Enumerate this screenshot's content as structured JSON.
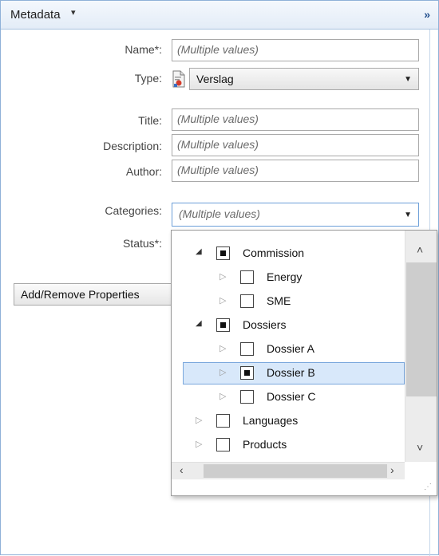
{
  "panel": {
    "title": "Metadata",
    "title_caret": "▾",
    "collapse_label": "»"
  },
  "fields": {
    "name": {
      "label": "Name*:",
      "value": "(Multiple values)"
    },
    "type": {
      "label": "Type:",
      "value": "Verslag",
      "icon": "document-report-icon"
    },
    "title": {
      "label": "Title:",
      "value": "(Multiple values)"
    },
    "description": {
      "label": "Description:",
      "value": "(Multiple values)"
    },
    "author": {
      "label": "Author:",
      "value": "(Multiple values)"
    },
    "categories": {
      "label": "Categories:",
      "value": "(Multiple values)"
    },
    "status": {
      "label": "Status*:"
    }
  },
  "add_remove_button": "Add/Remove Properties",
  "tree": {
    "items": [
      {
        "label": "Commission",
        "level": 0,
        "expanded": true,
        "check": "partial"
      },
      {
        "label": "Energy",
        "level": 1,
        "expanded": false,
        "check": "unchecked"
      },
      {
        "label": "SME",
        "level": 1,
        "expanded": false,
        "check": "unchecked"
      },
      {
        "label": "Dossiers",
        "level": 0,
        "expanded": true,
        "check": "partial"
      },
      {
        "label": "Dossier A",
        "level": 1,
        "expanded": false,
        "check": "unchecked"
      },
      {
        "label": "Dossier B",
        "level": 1,
        "expanded": false,
        "check": "partial",
        "selected": true
      },
      {
        "label": "Dossier C",
        "level": 1,
        "expanded": false,
        "check": "unchecked"
      },
      {
        "label": "Languages",
        "level": 0,
        "expanded": false,
        "check": "unchecked"
      },
      {
        "label": "Products",
        "level": 0,
        "expanded": false,
        "check": "unchecked"
      }
    ]
  },
  "colors": {
    "accent_border": "#6c9fd8",
    "selection_bg": "#d8e8fa",
    "header_bg": "#e3ecf7"
  }
}
